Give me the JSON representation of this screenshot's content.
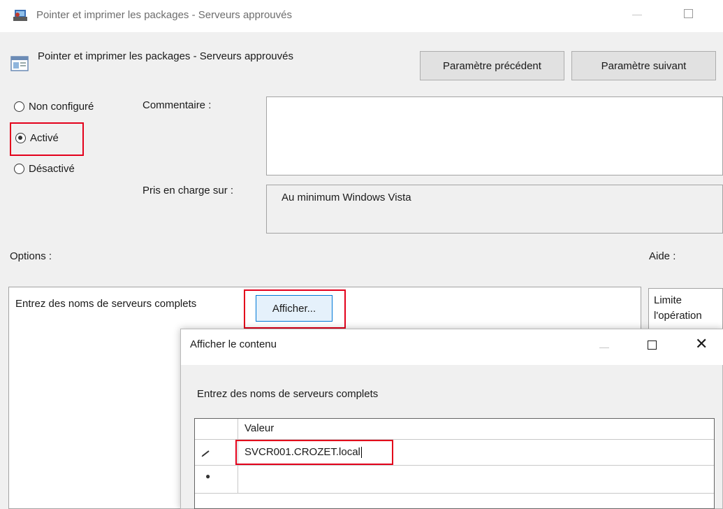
{
  "window": {
    "title": "Pointer et imprimer les packages - Serveurs approuvés",
    "icon": "printer-app-icon"
  },
  "policy": {
    "title": "Pointer et imprimer les packages - Serveurs approuvés",
    "icon": "policy-setting-icon",
    "prev_button": "Paramètre précédent",
    "next_button": "Paramètre suivant"
  },
  "state": {
    "options": [
      {
        "label": "Non configuré",
        "checked": false
      },
      {
        "label": "Activé",
        "checked": true
      },
      {
        "label": "Désactivé",
        "checked": false
      }
    ]
  },
  "comment": {
    "label": "Commentaire :",
    "value": ""
  },
  "supported": {
    "label": "Pris en charge sur :",
    "value": "Au minimum Windows Vista"
  },
  "options_section": {
    "label": "Options :",
    "servers_label": "Entrez des noms de serveurs complets",
    "show_button": "Afficher..."
  },
  "help_section": {
    "label": "Aide :",
    "text": "Limite l'opération"
  },
  "dialog": {
    "title": "Afficher le contenu",
    "instruction": "Entrez des noms de serveurs complets",
    "column_header": "Valeur",
    "rows": [
      {
        "marker": "pencil-icon",
        "value": "SVCR001.CROZET.local"
      },
      {
        "marker": "new-row-icon",
        "value": ""
      }
    ]
  },
  "colors": {
    "highlight": "#e3001b",
    "focus_blue": "#0078d7"
  }
}
